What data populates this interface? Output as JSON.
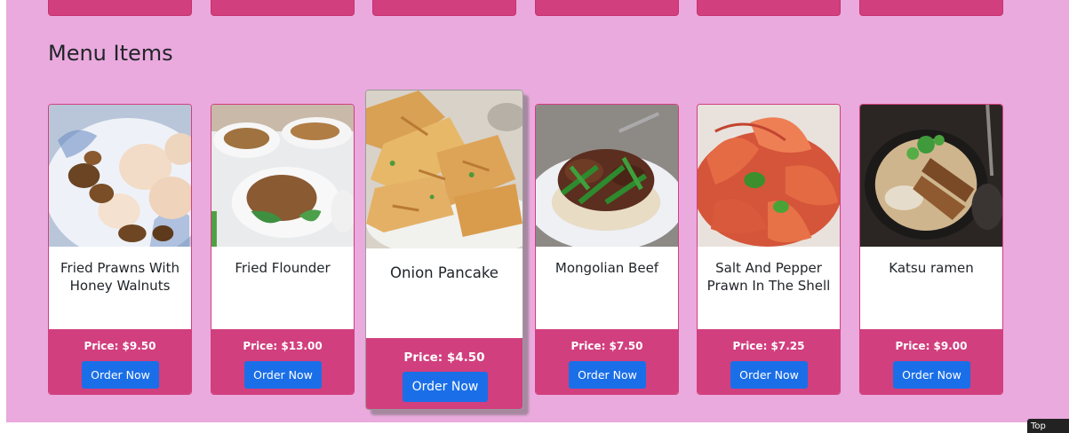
{
  "section": {
    "title": "Menu Items"
  },
  "colors": {
    "background": "#eaaade",
    "card_accent": "#d13f7e",
    "button": "#1a6fe8"
  },
  "items": [
    {
      "name": "Fried Prawns With Honey Walnuts",
      "price": "Price: $9.50",
      "button": "Order Now",
      "icon": "prawn-walnut-dish-image"
    },
    {
      "name": "Fried Flounder",
      "price": "Price: $13.00",
      "button": "Order Now",
      "icon": "flounder-dish-image"
    },
    {
      "name": "Onion Pancake",
      "price": "Price: $4.50",
      "button": "Order Now",
      "icon": "onion-pancake-image"
    },
    {
      "name": "Mongolian Beef",
      "price": "Price: $7.50",
      "button": "Order Now",
      "icon": "mongolian-beef-image"
    },
    {
      "name": "Salt And Pepper Prawn In The Shell",
      "price": "Price: $7.25",
      "button": "Order Now",
      "icon": "salt-pepper-prawn-image"
    },
    {
      "name": "Katsu ramen",
      "price": "Price: $9.00",
      "button": "Order Now",
      "icon": "katsu-ramen-image"
    }
  ],
  "corner_tag": {
    "label": "Top"
  }
}
